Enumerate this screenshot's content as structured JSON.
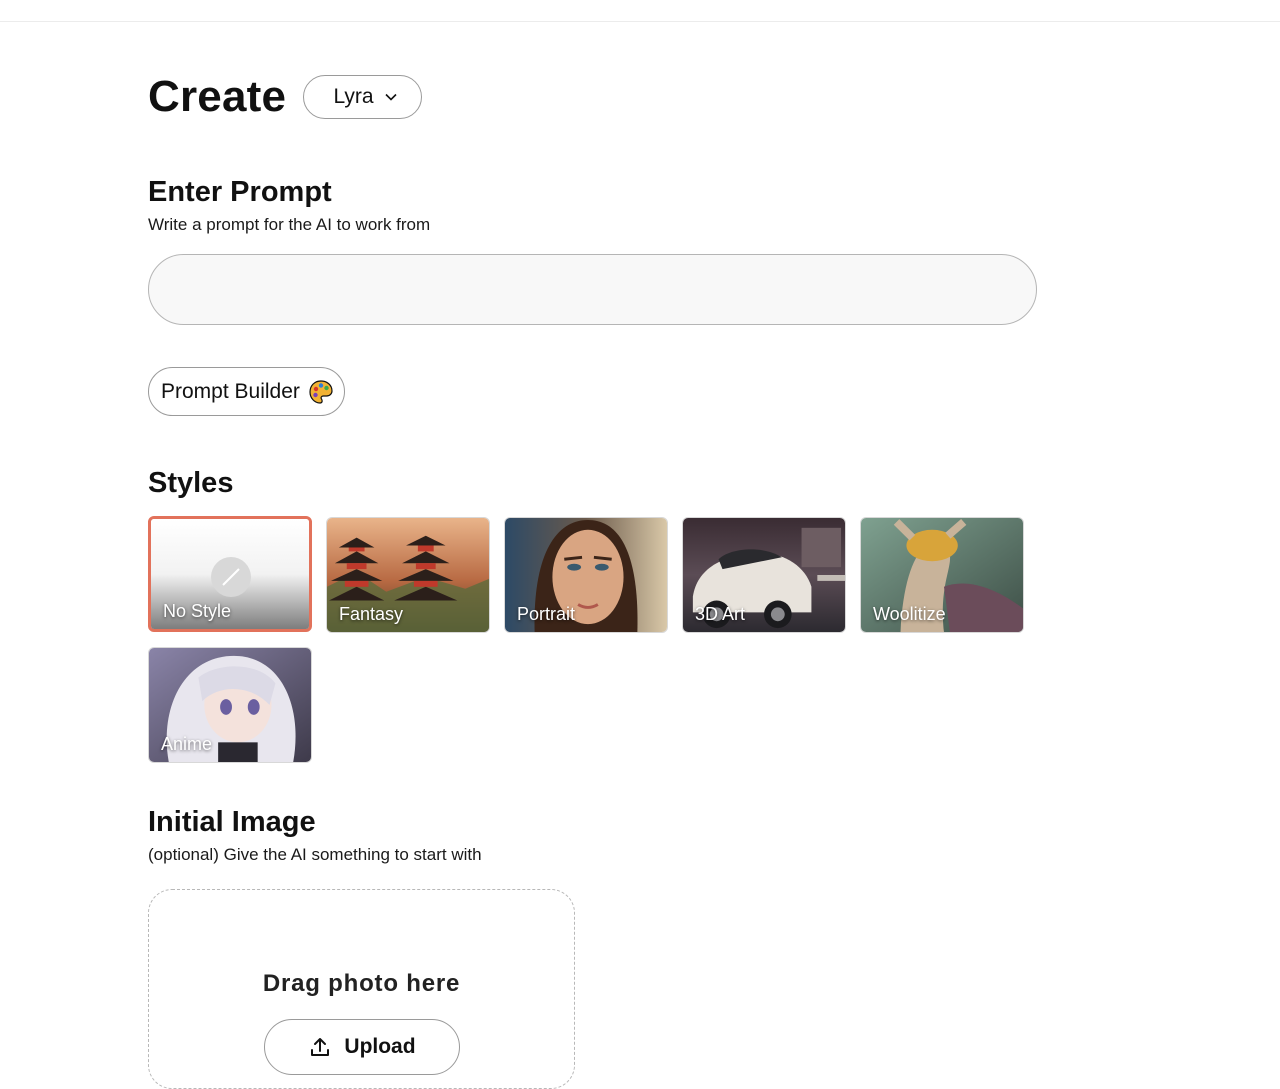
{
  "header": {
    "title": "Create",
    "model_selected": "Lyra"
  },
  "prompt": {
    "title": "Enter Prompt",
    "subtitle": "Write a prompt for the AI to work from",
    "value": "",
    "builder_label": "Prompt Builder"
  },
  "styles": {
    "title": "Styles",
    "selected": "No Style",
    "items": [
      {
        "label": "No Style"
      },
      {
        "label": "Fantasy"
      },
      {
        "label": "Portrait"
      },
      {
        "label": "3D Art"
      },
      {
        "label": "Woolitize"
      },
      {
        "label": "Anime"
      }
    ]
  },
  "initial_image": {
    "title": "Initial Image",
    "subtitle": "(optional) Give the AI something to start with",
    "drop_text": "Drag photo here",
    "upload_label": "Upload"
  },
  "colors": {
    "accent": "#e2725b"
  },
  "icons": {
    "model_dropdown": "chevron-down-icon",
    "prompt_builder": "palette-icon",
    "no_style": "slash-circle-icon",
    "upload": "upload-icon"
  }
}
